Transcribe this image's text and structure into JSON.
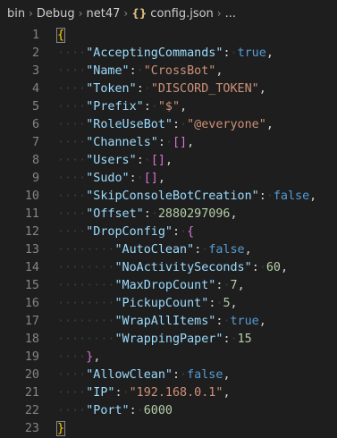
{
  "breadcrumb": {
    "items": [
      "bin",
      "Debug",
      "net47"
    ],
    "file_icon": "{}",
    "file": "config.json",
    "more": "..."
  },
  "lines": [
    {
      "n": "1",
      "indent": 0,
      "open": "{"
    },
    {
      "n": "2",
      "indent": 1,
      "key": "\"AcceptingCommands\"",
      "val": "true",
      "type": "bool",
      "comma": true
    },
    {
      "n": "3",
      "indent": 1,
      "key": "\"Name\"",
      "val": "\"CrossBot\"",
      "type": "str",
      "comma": true
    },
    {
      "n": "4",
      "indent": 1,
      "key": "\"Token\"",
      "val": "\"DISCORD_TOKEN\"",
      "type": "str",
      "comma": true
    },
    {
      "n": "5",
      "indent": 1,
      "key": "\"Prefix\"",
      "val": "\"$\"",
      "type": "str",
      "comma": true
    },
    {
      "n": "6",
      "indent": 1,
      "key": "\"RoleUseBot\"",
      "val": "\"@everyone\"",
      "type": "str",
      "comma": true
    },
    {
      "n": "7",
      "indent": 1,
      "key": "\"Channels\"",
      "val": "[]",
      "type": "punct",
      "comma": true
    },
    {
      "n": "8",
      "indent": 1,
      "key": "\"Users\"",
      "val": "[]",
      "type": "punct",
      "comma": true
    },
    {
      "n": "9",
      "indent": 1,
      "key": "\"Sudo\"",
      "val": "[]",
      "type": "punct",
      "comma": true
    },
    {
      "n": "10",
      "indent": 1,
      "key": "\"SkipConsoleBotCreation\"",
      "val": "false",
      "type": "bool",
      "comma": true
    },
    {
      "n": "11",
      "indent": 1,
      "key": "\"Offset\"",
      "val": "2880297096",
      "type": "num",
      "comma": true
    },
    {
      "n": "12",
      "indent": 1,
      "key": "\"DropConfig\"",
      "val": "{",
      "type": "brace2",
      "comma": false
    },
    {
      "n": "13",
      "indent": 2,
      "key": "\"AutoClean\"",
      "val": "false",
      "type": "bool",
      "comma": true
    },
    {
      "n": "14",
      "indent": 2,
      "key": "\"NoActivitySeconds\"",
      "val": "60",
      "type": "num",
      "comma": true
    },
    {
      "n": "15",
      "indent": 2,
      "key": "\"MaxDropCount\"",
      "val": "7",
      "type": "num",
      "comma": true
    },
    {
      "n": "16",
      "indent": 2,
      "key": "\"PickupCount\"",
      "val": "5",
      "type": "num",
      "comma": true
    },
    {
      "n": "17",
      "indent": 2,
      "key": "\"WrapAllItems\"",
      "val": "true",
      "type": "bool",
      "comma": true
    },
    {
      "n": "18",
      "indent": 2,
      "key": "\"WrappingPaper\"",
      "val": "15",
      "type": "num",
      "comma": false
    },
    {
      "n": "19",
      "indent": 1,
      "close2": "}",
      "comma": true
    },
    {
      "n": "20",
      "indent": 1,
      "key": "\"AllowClean\"",
      "val": "false",
      "type": "bool",
      "comma": true
    },
    {
      "n": "21",
      "indent": 1,
      "key": "\"IP\"",
      "val": "\"192.168.0.1\"",
      "type": "str",
      "comma": true
    },
    {
      "n": "22",
      "indent": 1,
      "key": "\"Port\"",
      "val": "6000",
      "type": "num",
      "comma": false
    },
    {
      "n": "23",
      "indent": 0,
      "close": "}"
    }
  ]
}
